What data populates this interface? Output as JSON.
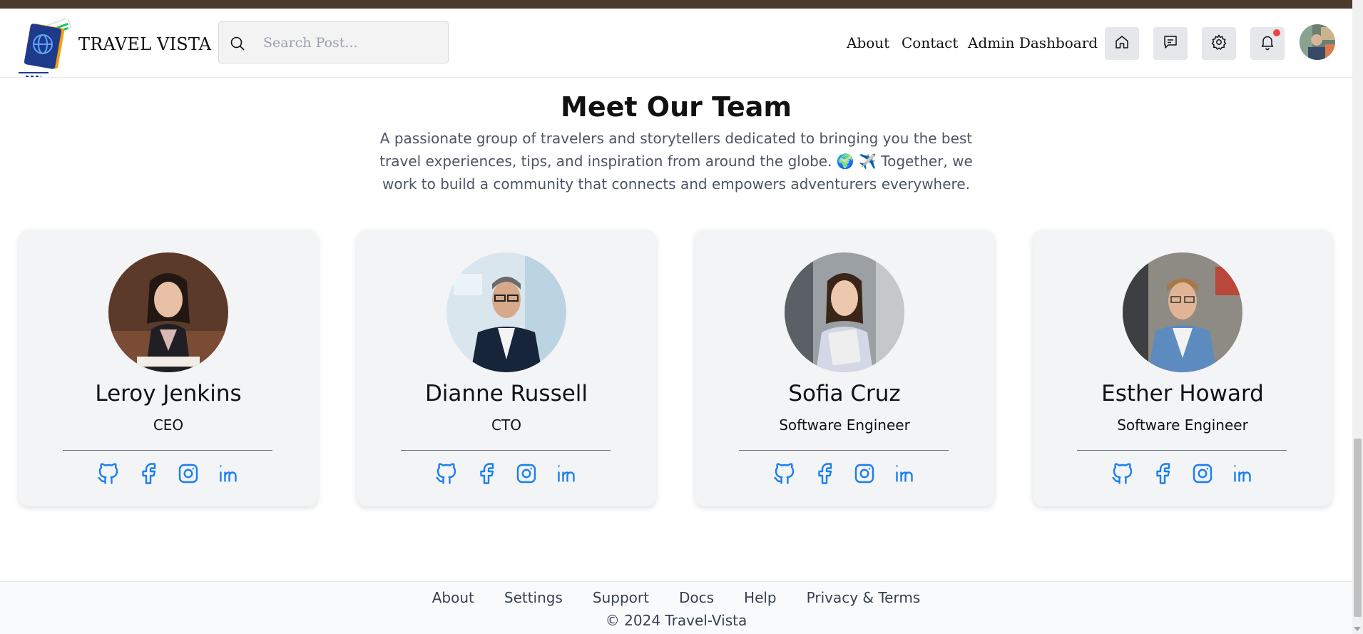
{
  "header": {
    "brand": "TRAVEL VISTA",
    "search_placeholder": "Search Post...",
    "nav": {
      "about": "About",
      "contact": "Contact",
      "admin": "Admin Dashboard"
    },
    "icons": [
      "home-icon",
      "chat-icon",
      "gear-icon",
      "bell-icon"
    ]
  },
  "team": {
    "title": "Meet Our Team",
    "description": "A passionate group of travelers and storytellers dedicated to bringing you the best travel experiences, tips, and inspiration from around the globe. 🌍 ✈️ Together, we work to build a community that connects and empowers adventurers everywhere.",
    "members": [
      {
        "name": "Leroy Jenkins",
        "role": "CEO"
      },
      {
        "name": "Dianne Russell",
        "role": "CTO"
      },
      {
        "name": "Sofia Cruz",
        "role": "Software Engineer"
      },
      {
        "name": "Esther Howard",
        "role": "Software Engineer"
      }
    ],
    "social_icons": [
      "github-icon",
      "facebook-icon",
      "instagram-icon",
      "linkedin-icon"
    ]
  },
  "footer": {
    "links": [
      "About",
      "Settings",
      "Support",
      "Docs",
      "Help",
      "Privacy & Terms"
    ],
    "copyright": "© 2024 Travel-Vista"
  },
  "colors": {
    "accent": "#1a7ef0",
    "notification": "#ef4444",
    "card_bg": "#f3f4f6"
  }
}
